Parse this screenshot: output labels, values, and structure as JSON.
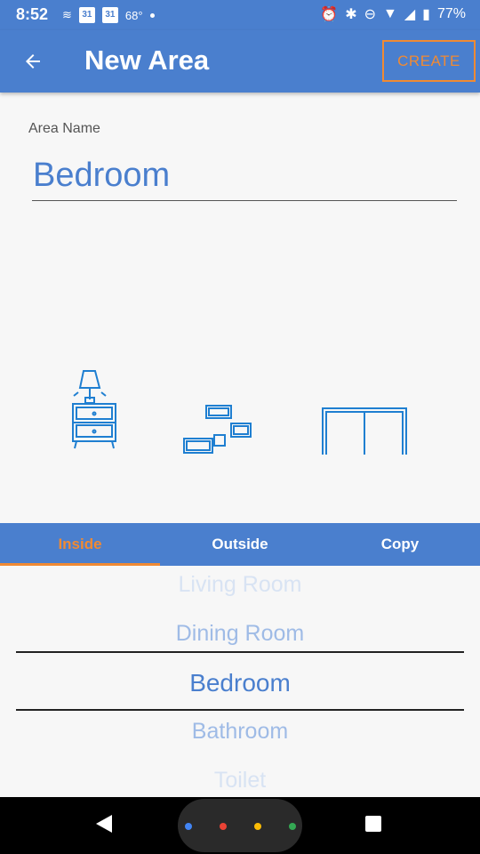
{
  "status_bar": {
    "time": "8:52",
    "cal1": "31",
    "cal2": "31",
    "temp": "68°",
    "battery": "77%"
  },
  "app_bar": {
    "title": "New Area",
    "create_label": "CREATE",
    "back_icon": "arrow-left-icon"
  },
  "form": {
    "label": "Area Name",
    "value": "Bedroom"
  },
  "tabs": [
    {
      "label": "Inside",
      "active": true
    },
    {
      "label": "Outside",
      "active": false
    },
    {
      "label": "Copy",
      "active": false
    }
  ],
  "picker": {
    "items": [
      "Living Room",
      "Dining Room",
      "Bedroom",
      "Bathroom",
      "Toilet"
    ],
    "selected": "Bedroom"
  },
  "colors": {
    "primary": "#4a7fce",
    "accent": "#f08a33",
    "illustration": "#1f7fd1"
  }
}
